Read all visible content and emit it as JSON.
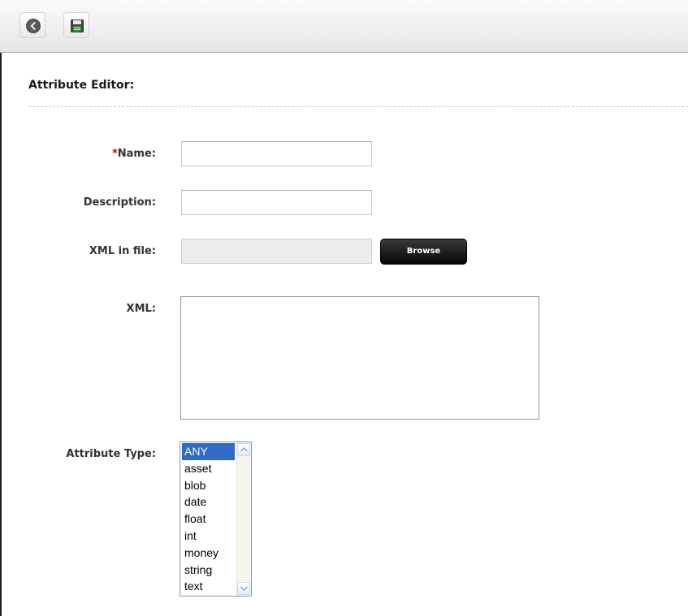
{
  "toolbar": {
    "back_icon": "back-arrow-circle-icon",
    "save_icon": "floppy-disk-save-icon"
  },
  "page": {
    "title": "Attribute Editor:"
  },
  "form": {
    "name_required_marker": "*",
    "name_label": "Name:",
    "name_value": "",
    "description_label": "Description:",
    "description_value": "",
    "xml_file_label": "XML in file:",
    "xml_file_value": "",
    "browse_label": "Browse",
    "xml_label": "XML:",
    "xml_value": "",
    "attribute_type_label": "Attribute Type:",
    "attribute_type_options": [
      "ANY",
      "asset",
      "blob",
      "date",
      "float",
      "int",
      "money",
      "string",
      "text"
    ],
    "attribute_type_selected": "ANY"
  },
  "colors": {
    "required": "#cc0000",
    "selection": "#316ac5",
    "button_dark": "#050505"
  }
}
